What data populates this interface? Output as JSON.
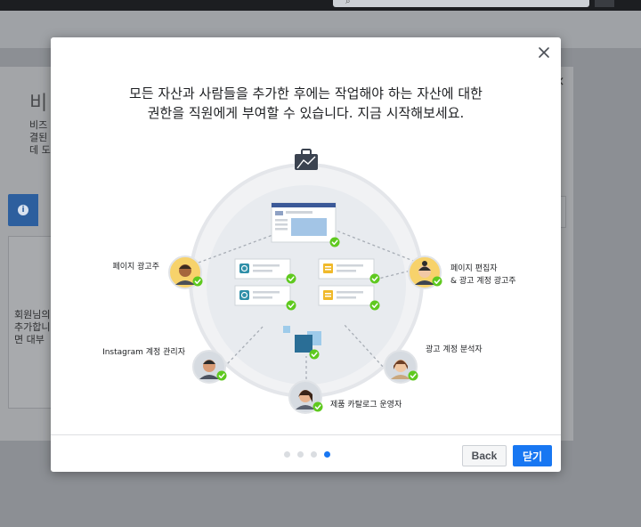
{
  "modal": {
    "headline_line1": "모든 자산과 사람들을 추가한 후에는 작업해야 하는 자산에 대한",
    "headline_line2": "권한을 직원에게 부여할 수 있습니다. 지금 시작해보세요.",
    "roles": {
      "page_advertiser": "페이지 광고주",
      "page_editor_line1": "페이지 편집자",
      "page_editor_line2": "& 광고 계정 광고주",
      "instagram_manager": "Instagram 계정 관리자",
      "ad_analyst": "광고 계정 분석자",
      "catalog_operator": "제품 카탈로그 운영자"
    },
    "pagination": {
      "total": 4,
      "current": 4
    },
    "back_label": "Back",
    "close_label": "닫기"
  },
  "background": {
    "title_fragment": "비",
    "desc_lines": [
      "비즈",
      "결된",
      "데 도"
    ],
    "panel_lines": [
      "회원님의",
      "추가합니",
      "면 대부"
    ]
  },
  "colors": {
    "accent": "#1877f2",
    "check_green": "#5fc91f",
    "avatar_yellow": "#f7d26b",
    "avatar_grey": "#d6dbe1"
  }
}
